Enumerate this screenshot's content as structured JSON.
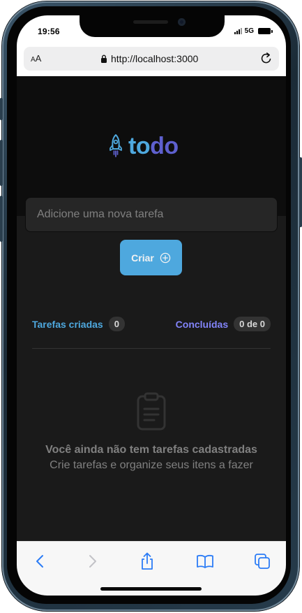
{
  "status_bar": {
    "time": "19:56",
    "network": "5G"
  },
  "browser": {
    "text_size_label_small": "A",
    "text_size_label_large": "A",
    "url": "http://localhost:3000",
    "lock_icon": "lock-icon",
    "reload_icon": "reload-icon"
  },
  "app": {
    "logo_part1": "to",
    "logo_part2": "do",
    "logo_icon": "rocket-icon",
    "new_task_placeholder": "Adicione uma nova tarefa",
    "create_label": "Criar",
    "create_icon": "plus-circle-icon",
    "counters": {
      "created_label": "Tarefas criadas",
      "created_value": "0",
      "done_label": "Concluídas",
      "done_value": "0 de 0"
    },
    "empty_state": {
      "icon": "clipboard-icon",
      "title": "Você ainda não tem tarefas cadastradas",
      "subtitle": "Crie tarefas e organize seus itens a fazer"
    }
  },
  "toolbar": {
    "items": [
      "back-icon",
      "forward-icon",
      "share-icon",
      "bookmarks-icon",
      "tabs-icon"
    ]
  },
  "colors": {
    "blue": "#4ea8de",
    "purple": "#5e60ce",
    "purple_light": "#8284fa",
    "bg": "#1a1a1a",
    "header_bg": "#0d0d0d"
  }
}
